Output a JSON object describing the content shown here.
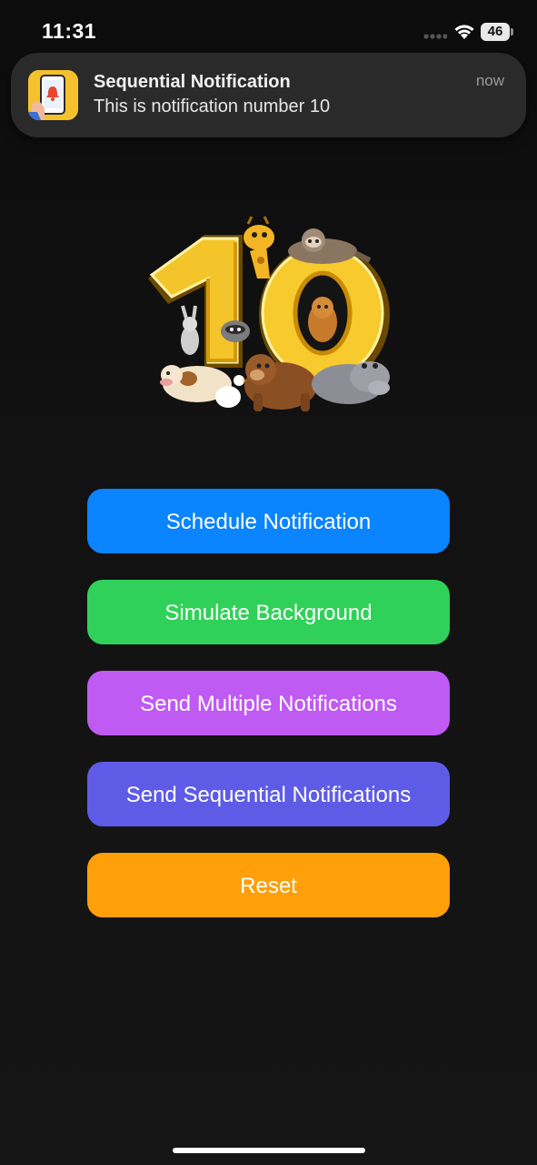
{
  "status_bar": {
    "time": "11:31",
    "battery_level": "46"
  },
  "notification": {
    "title": "Sequential Notification",
    "body": "This is notification number 10",
    "time": "now",
    "icon": "phone-with-bell-app-icon"
  },
  "hero": {
    "icon": "number-ten-with-cartoon-animals"
  },
  "buttons": [
    {
      "label": "Schedule Notification",
      "color": "#0a84ff"
    },
    {
      "label": "Simulate Background",
      "color": "#30d158"
    },
    {
      "label": "Send Multiple Notifications",
      "color": "#bf5af2"
    },
    {
      "label": "Send Sequential Notifications",
      "color": "#5e5ce6"
    },
    {
      "label": "Reset",
      "color": "#ff9f0a"
    }
  ]
}
